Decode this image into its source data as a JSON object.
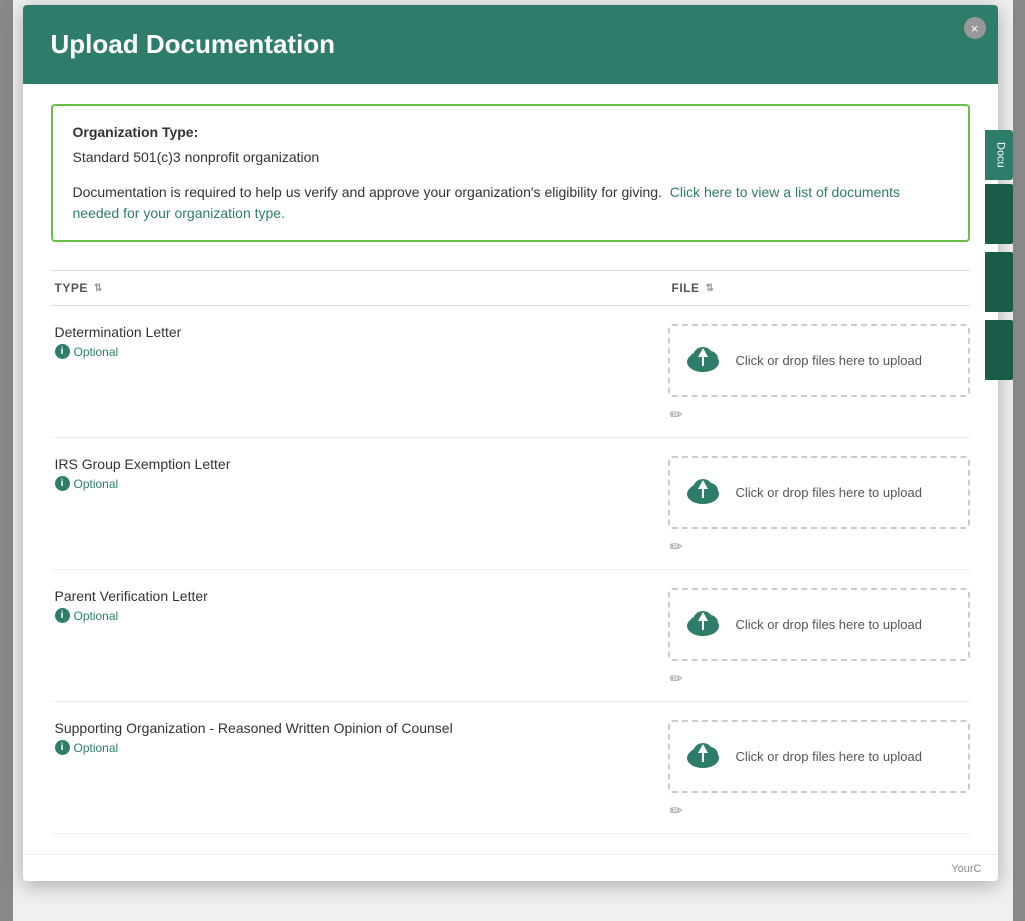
{
  "modal": {
    "title": "Upload Documentation",
    "close_button_label": "×"
  },
  "info_box": {
    "org_type_label": "Organization Type:",
    "org_type_value": "Standard 501(c)3 nonprofit organization",
    "description": "Documentation is required to help us verify and approve your organization's eligibility for giving.",
    "link_text": "Click here to view a list of documents needed for your organization type."
  },
  "table": {
    "col_type": "TYPE",
    "col_file": "FILE",
    "rows": [
      {
        "doc_name": "Determination Letter",
        "optional_label": "Optional",
        "upload_text": "Click or drop files here to upload"
      },
      {
        "doc_name": "IRS Group Exemption Letter",
        "optional_label": "Optional",
        "upload_text": "Click or drop files here to upload"
      },
      {
        "doc_name": "Parent Verification Letter",
        "optional_label": "Optional",
        "upload_text": "Click or drop files here to upload"
      },
      {
        "doc_name": "Supporting Organization - Reasoned Written Opinion of Counsel",
        "optional_label": "Optional",
        "upload_text": "Click or drop files here to upload"
      }
    ]
  },
  "sidebar": {
    "tab_label": "Docu"
  },
  "footer": {
    "text": "YourC"
  },
  "colors": {
    "brand_green": "#2e7d6b",
    "light_green_border": "#6abf4b"
  }
}
